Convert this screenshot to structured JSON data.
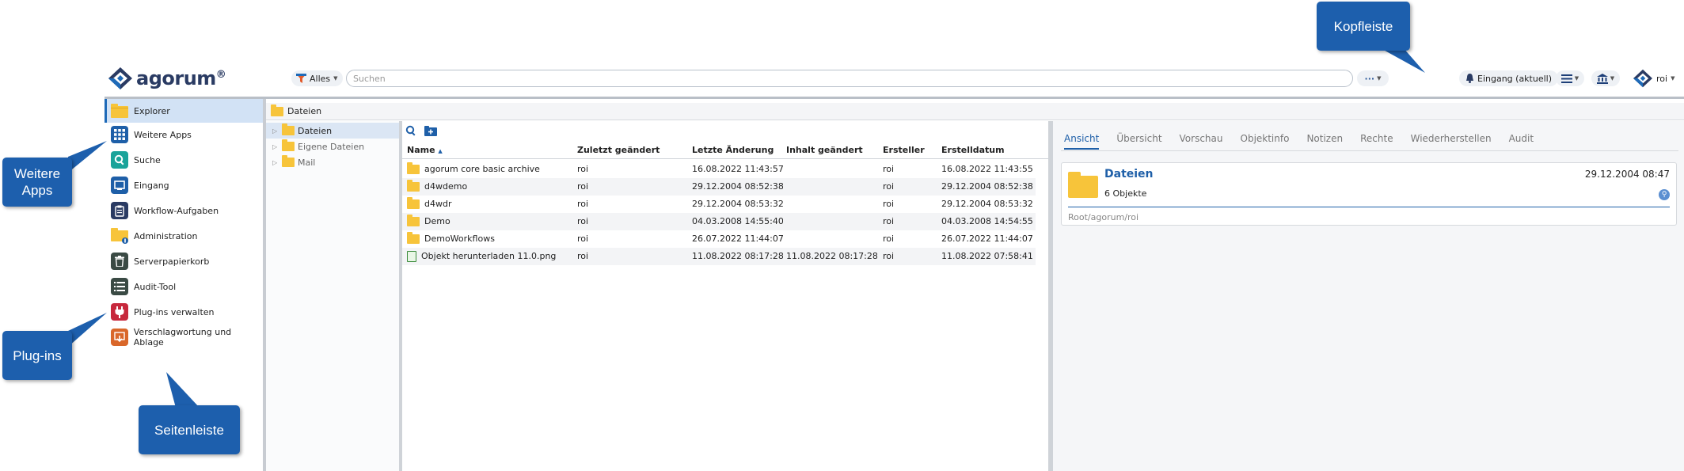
{
  "app": {
    "logo_text": "agorum",
    "logo_mark": "®"
  },
  "header": {
    "filter_label": "Alles",
    "search_placeholder": "Suchen",
    "more_label": "···",
    "inbox_label": "Eingang (aktuell)",
    "user_label": "roi"
  },
  "sidebar": {
    "items": [
      {
        "label": "Explorer",
        "icon": "folder-icon",
        "color": "#f7c43a"
      },
      {
        "label": "Weitere Apps",
        "icon": "apps-grid-icon",
        "color": "#1e5fa8"
      },
      {
        "label": "Suche",
        "icon": "search-icon",
        "color": "#1aa39a"
      },
      {
        "label": "Eingang",
        "icon": "inbox-icon",
        "color": "#1e5fa8"
      },
      {
        "label": "Workflow-Aufgaben",
        "icon": "clipboard-icon",
        "color": "#2a3b63"
      },
      {
        "label": "Administration",
        "icon": "admin-folder-icon",
        "color": "#f7c43a"
      },
      {
        "label": "Serverpapierkorb",
        "icon": "trash-icon",
        "color": "#3a4a44"
      },
      {
        "label": "Audit-Tool",
        "icon": "list-icon",
        "color": "#3a4a44"
      },
      {
        "label": "Plug-ins verwalten",
        "icon": "plugin-icon",
        "color": "#c7283c"
      },
      {
        "label": "Verschlagwortung und Ablage",
        "icon": "tagging-icon",
        "color": "#d9672a"
      }
    ]
  },
  "breadcrumb": {
    "label": "Dateien"
  },
  "tree": {
    "items": [
      {
        "label": "Dateien"
      },
      {
        "label": "Eigene Dateien"
      },
      {
        "label": "Mail"
      }
    ]
  },
  "list": {
    "columns": [
      "Name",
      "Zuletzt geändert durch",
      "Letzte Änderung",
      "Inhalt geändert",
      "Ersteller",
      "Erstelldatum"
    ],
    "sort_indicator": "▲",
    "rows": [
      {
        "name": "agorum core basic archive",
        "type": "folder",
        "modified_by": "roi",
        "modified": "16.08.2022 11:43:57",
        "content_changed": "",
        "creator": "roi",
        "created": "16.08.2022 11:43:55"
      },
      {
        "name": "d4wdemo",
        "type": "folder",
        "modified_by": "roi",
        "modified": "29.12.2004 08:52:38",
        "content_changed": "",
        "creator": "roi",
        "created": "29.12.2004 08:52:38"
      },
      {
        "name": "d4wdr",
        "type": "folder",
        "modified_by": "roi",
        "modified": "29.12.2004 08:53:32",
        "content_changed": "",
        "creator": "roi",
        "created": "29.12.2004 08:53:32"
      },
      {
        "name": "Demo",
        "type": "folder",
        "modified_by": "roi",
        "modified": "04.03.2008 14:55:40",
        "content_changed": "",
        "creator": "roi",
        "created": "04.03.2008 14:54:55"
      },
      {
        "name": "DemoWorkflows",
        "type": "folder",
        "modified_by": "roi",
        "modified": "26.07.2022 11:44:07",
        "content_changed": "",
        "creator": "roi",
        "created": "26.07.2022 11:44:07"
      },
      {
        "name": "Objekt herunterladen 11.0.png",
        "type": "png",
        "modified_by": "roi",
        "modified": "11.08.2022 08:17:28",
        "content_changed": "11.08.2022 08:17:28",
        "creator": "roi",
        "created": "11.08.2022 07:58:41"
      }
    ]
  },
  "detail": {
    "tabs": [
      "Ansicht",
      "Übersicht",
      "Vorschau",
      "Objektinfo",
      "Notizen",
      "Rechte",
      "Wiederherstellen",
      "Audit"
    ],
    "active_tab": 0,
    "title": "Dateien",
    "date": "29.12.2004 08:47",
    "subtitle": "6 Objekte",
    "path": [
      "Root",
      "agorum",
      "roi"
    ],
    "path_sep": "/"
  },
  "callouts": {
    "kopfleiste": "Kopfleiste",
    "weitere_apps_1": "Weitere",
    "weitere_apps_2": "Apps",
    "plugins": "Plug-ins",
    "seitenleiste": "Seitenleiste"
  },
  "colors": {
    "accent": "#1e5fa8",
    "callout": "#1d5fad",
    "folder": "#f7c43a",
    "active_bg": "#d2e2f5"
  }
}
